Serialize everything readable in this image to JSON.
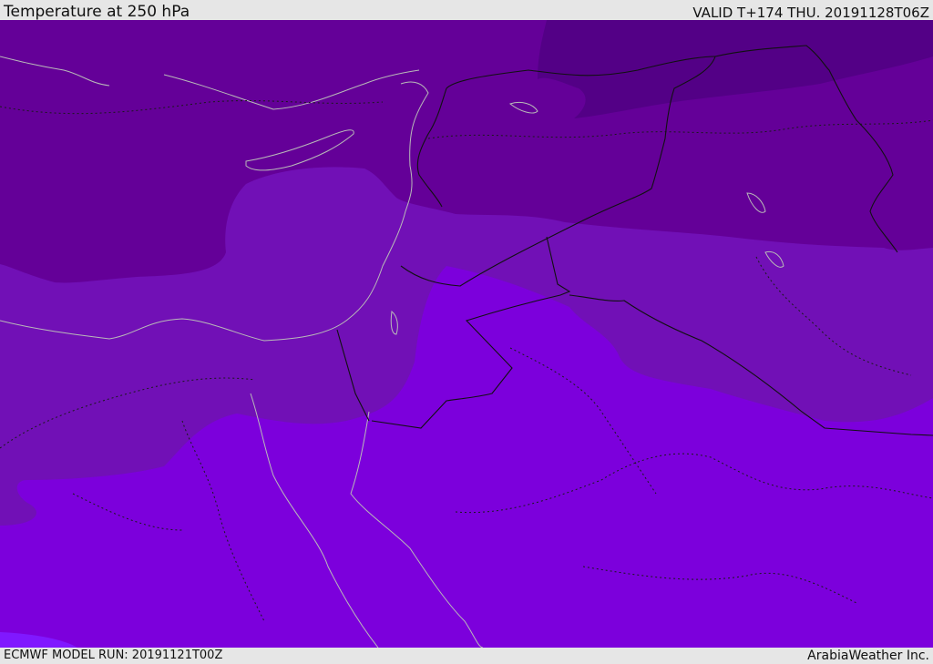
{
  "header": {
    "title": "Temperature at 250 hPa",
    "valid_time": "VALID T+174 THU. 20191128T06Z"
  },
  "footer": {
    "model_run": "ECMWF MODEL RUN: 20191121T00Z",
    "credit": "ArabiaWeather Inc."
  },
  "map": {
    "colors": {
      "coldest": "#530086",
      "cold": "#640098",
      "mid": "#7110b6",
      "warm": "#7c00dc",
      "warmest": "#8018ff",
      "coastline": "#b9b9b9",
      "border": "#111111"
    }
  }
}
